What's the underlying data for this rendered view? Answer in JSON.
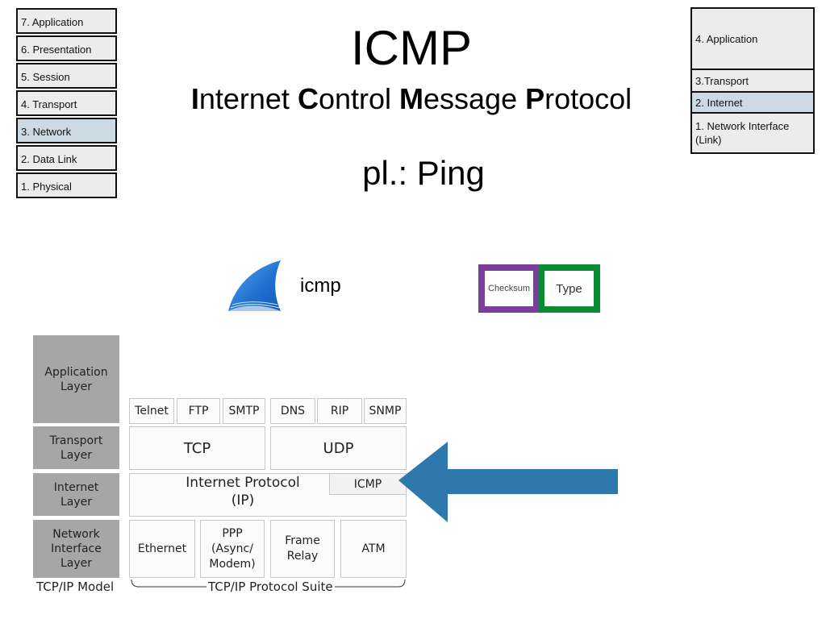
{
  "osi_model": {
    "layers": [
      {
        "label": "7. Application",
        "highlighted": false
      },
      {
        "label": "6. Presentation",
        "highlighted": false
      },
      {
        "label": "5. Session",
        "highlighted": false
      },
      {
        "label": "4. Transport",
        "highlighted": false
      },
      {
        "label": "3. Network",
        "highlighted": true
      },
      {
        "label": "2. Data Link",
        "highlighted": false
      },
      {
        "label": "1. Physical",
        "highlighted": false
      }
    ]
  },
  "tcpip_model_box": {
    "layers": [
      {
        "label": "4. Application",
        "highlighted": false
      },
      {
        "label": "3.Transport",
        "highlighted": false
      },
      {
        "label": "2. Internet",
        "highlighted": true
      },
      {
        "label": "1. Network Interface (Link)",
        "highlighted": false
      }
    ]
  },
  "heading": {
    "title": "ICMP",
    "subtitle_parts": [
      {
        "text": "I",
        "bold": true
      },
      {
        "text": "nternet ",
        "bold": false
      },
      {
        "text": "C",
        "bold": true
      },
      {
        "text": "ontrol ",
        "bold": false
      },
      {
        "text": "M",
        "bold": true
      },
      {
        "text": "essage ",
        "bold": false
      },
      {
        "text": "P",
        "bold": true
      },
      {
        "text": "rotocol",
        "bold": false
      }
    ],
    "example": "pl.: Ping"
  },
  "wireshark": {
    "icon": "wireshark-fin-icon",
    "filter_text": "icmp"
  },
  "header_fields": [
    {
      "label": "Checksum",
      "color": "#7a3f9a"
    },
    {
      "label": "Type",
      "color": "#0c8a34"
    }
  ],
  "diagram": {
    "model_layers": [
      {
        "label": "Application Layer"
      },
      {
        "label": "Transport Layer"
      },
      {
        "label": "Internet Layer"
      },
      {
        "label": "Network Interface Layer"
      }
    ],
    "application_protocols": [
      "Telnet",
      "FTP",
      "SMTP",
      "DNS",
      "RIP",
      "SNMP"
    ],
    "transport_protocols": [
      "TCP",
      "UDP"
    ],
    "internet_protocol": "Internet Protocol (IP)",
    "internet_protocol_line1": "Internet Protocol",
    "internet_protocol_line2": "(IP)",
    "icmp_label": "ICMP",
    "network_interface_protocols": [
      "Ethernet",
      "PPP (Async/ Modem)",
      "Frame Relay",
      "ATM"
    ],
    "model_caption": "TCP/IP Model",
    "suite_caption": "TCP/IP Protocol Suite"
  },
  "arrow": {
    "direction": "left",
    "color": "#2e78ad",
    "points_to": "ICMP"
  }
}
